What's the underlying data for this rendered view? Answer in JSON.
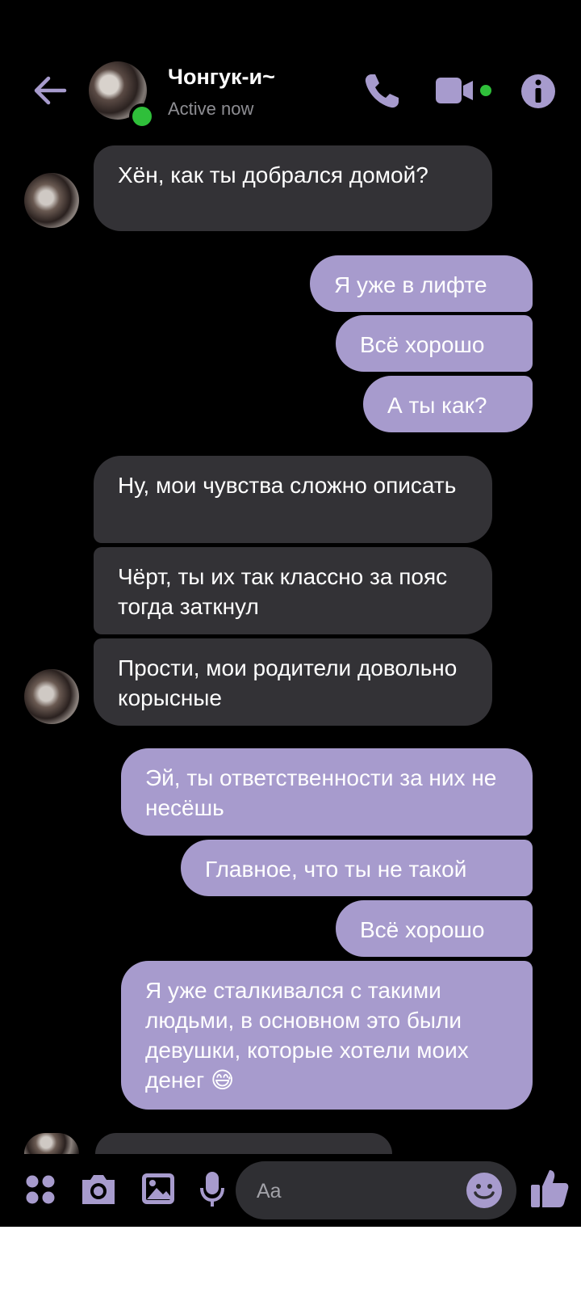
{
  "header": {
    "name": "Чонгук-и~",
    "status": "Active now",
    "icons": [
      "back-arrow-icon",
      "phone-icon",
      "video-camera-icon",
      "info-icon"
    ]
  },
  "messages": [
    {
      "side": "in",
      "text": "Хён, как ты добрался домой?"
    },
    {
      "side": "out",
      "text": "Я уже в лифте"
    },
    {
      "side": "out",
      "text": "Всё хорошо"
    },
    {
      "side": "out",
      "text": "А ты как?"
    },
    {
      "side": "in",
      "text": "Ну, мои чувства сложно описать"
    },
    {
      "side": "in",
      "text": "Чёрт, ты их так классно за пояс тогда заткнул"
    },
    {
      "side": "in",
      "text": "Прости, мои родители довольно корысные"
    },
    {
      "side": "out",
      "text": "Эй, ты  ответственности за них не несёшь"
    },
    {
      "side": "out",
      "text": "Главное, что ты не такой"
    },
    {
      "side": "out",
      "text": "Всё хорошо"
    },
    {
      "side": "out",
      "text": "Я уже сталкивался с такими людьми, в основном это были девушки, которые хотели моих денег 😅"
    }
  ],
  "composer": {
    "placeholder": "Aa",
    "icons": [
      "menu-dots-icon",
      "camera-icon",
      "gallery-icon",
      "microphone-icon",
      "emoji-icon",
      "thumbs-up-icon"
    ]
  },
  "colors": {
    "accent": "#a79bcd",
    "incoming_bubble": "#333236",
    "online": "#2fbf3a",
    "background": "#000000"
  }
}
